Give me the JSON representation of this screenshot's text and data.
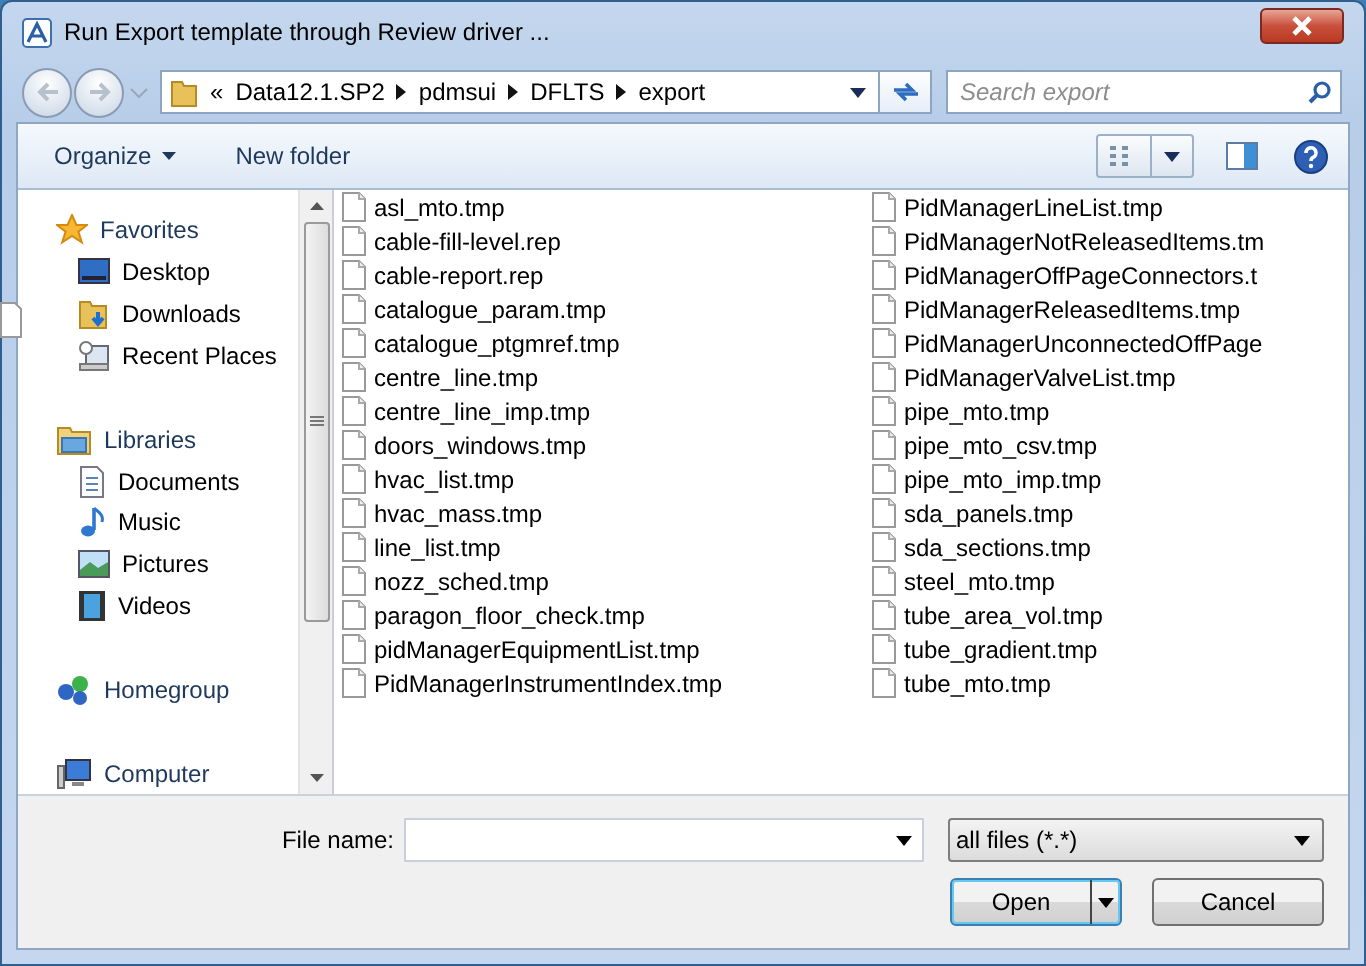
{
  "window": {
    "title": "Run Export template through Review driver ..."
  },
  "address": {
    "overflow": "«",
    "segments": [
      "Data12.1.SP2",
      "pdmsui",
      "DFLTS",
      "export"
    ]
  },
  "search": {
    "placeholder": "Search export"
  },
  "toolbar": {
    "organize": "Organize",
    "new_folder": "New folder"
  },
  "nav_pane": {
    "groups": [
      {
        "label": "Favorites",
        "children": [
          "Desktop",
          "Downloads",
          "Recent Places"
        ]
      },
      {
        "label": "Libraries",
        "children": [
          "Documents",
          "Music",
          "Pictures",
          "Videos"
        ]
      },
      {
        "label": "Homegroup"
      },
      {
        "label": "Computer"
      }
    ]
  },
  "files": [
    "asl_mto.tmp",
    "cable-fill-level.rep",
    "cable-report.rep",
    "catalogue_param.tmp",
    "catalogue_ptgmref.tmp",
    "centre_line.tmp",
    "centre_line_imp.tmp",
    "doors_windows.tmp",
    "hvac_list.tmp",
    "hvac_mass.tmp",
    "line_list.tmp",
    "nozz_sched.tmp",
    "paragon_floor_check.tmp",
    "pidManagerEquipmentList.tmp",
    "PidManagerInstrumentIndex.tmp",
    "PidManagerLineList.tmp",
    "PidManagerNotReleasedItems.tm",
    "PidManagerOffPageConnectors.t",
    "PidManagerReleasedItems.tmp",
    "PidManagerUnconnectedOffPage",
    "PidManagerValveList.tmp",
    "pipe_mto.tmp",
    "pipe_mto_csv.tmp",
    "pipe_mto_imp.tmp",
    "sda_panels.tmp",
    "sda_sections.tmp",
    "steel_mto.tmp",
    "tube_area_vol.tmp",
    "tube_gradient.tmp",
    "tube_mto.tmp"
  ],
  "file_name": {
    "label": "File name:"
  },
  "file_type": {
    "value": "all files (*.*)"
  },
  "buttons": [
    {
      "label": "Open",
      "kind": "split",
      "default": true
    },
    {
      "label": "Cancel",
      "kind": "plain",
      "default": false
    }
  ]
}
